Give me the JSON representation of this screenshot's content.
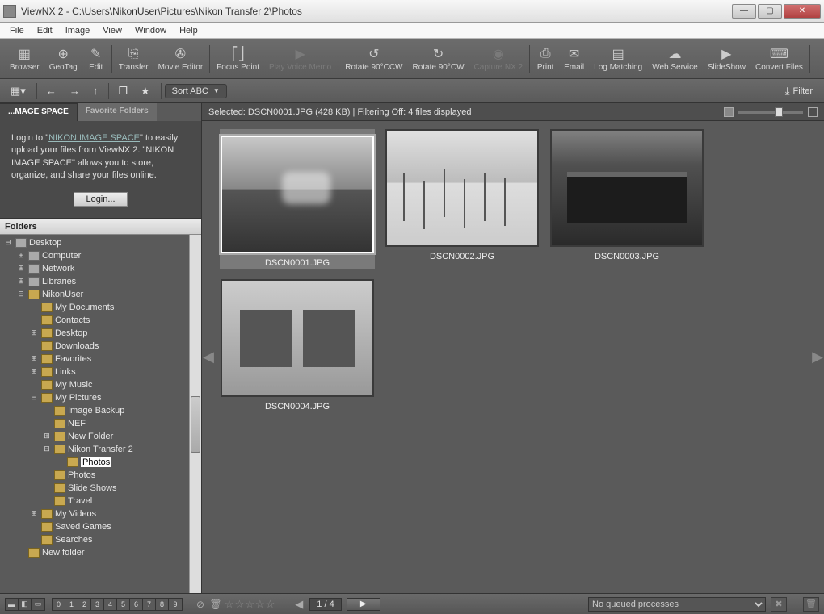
{
  "window": {
    "title": "ViewNX 2 - C:\\Users\\NikonUser\\Pictures\\Nikon Transfer 2\\Photos"
  },
  "menu": [
    "File",
    "Edit",
    "Image",
    "View",
    "Window",
    "Help"
  ],
  "toolbar": [
    {
      "label": "Browser",
      "icon": "▦"
    },
    {
      "label": "GeoTag",
      "icon": "⊕"
    },
    {
      "label": "Edit",
      "icon": "✎"
    },
    {
      "label": "Transfer",
      "icon": "⎘"
    },
    {
      "label": "Movie Editor",
      "icon": "✇"
    },
    {
      "label": "Focus Point",
      "icon": "⎡⎦"
    },
    {
      "label": "Play Voice Memo",
      "icon": "▶",
      "disabled": true
    },
    {
      "label": "Rotate 90°CCW",
      "icon": "↺"
    },
    {
      "label": "Rotate 90°CW",
      "icon": "↻"
    },
    {
      "label": "Capture NX 2",
      "icon": "◉",
      "disabled": true
    },
    {
      "label": "Print",
      "icon": "⎙"
    },
    {
      "label": "Email",
      "icon": "✉"
    },
    {
      "label": "Log Matching",
      "icon": "▤"
    },
    {
      "label": "Web Service",
      "icon": "☁"
    },
    {
      "label": "SlideShow",
      "icon": "▶"
    },
    {
      "label": "Convert Files",
      "icon": "⌨"
    }
  ],
  "secbar": {
    "sort_label": "Sort ABC",
    "filter_label": "Filter"
  },
  "sidebar": {
    "tab_active": "...MAGE SPACE",
    "tab_inactive": "Favorite Folders",
    "nis_text_1": "Login to \"",
    "nis_link": "NIKON IMAGE SPACE",
    "nis_text_2": "\" to easily upload your files from ViewNX 2. \"NIKON IMAGE SPACE\" allows you to store, organize, and share your files online.",
    "login_label": "Login...",
    "folders_label": "Folders",
    "tree": [
      {
        "exp": "-",
        "indent": 0,
        "label": "Desktop",
        "type": "comp"
      },
      {
        "exp": "+",
        "indent": 1,
        "label": "Computer",
        "type": "comp"
      },
      {
        "exp": "+",
        "indent": 1,
        "label": "Network",
        "type": "comp"
      },
      {
        "exp": "+",
        "indent": 1,
        "label": "Libraries",
        "type": "comp"
      },
      {
        "exp": "-",
        "indent": 1,
        "label": "NikonUser",
        "type": "fold"
      },
      {
        "exp": " ",
        "indent": 2,
        "label": "My Documents",
        "type": "fold"
      },
      {
        "exp": " ",
        "indent": 2,
        "label": "Contacts",
        "type": "fold"
      },
      {
        "exp": "+",
        "indent": 2,
        "label": "Desktop",
        "type": "fold"
      },
      {
        "exp": " ",
        "indent": 2,
        "label": "Downloads",
        "type": "fold"
      },
      {
        "exp": "+",
        "indent": 2,
        "label": "Favorites",
        "type": "fold"
      },
      {
        "exp": "+",
        "indent": 2,
        "label": "Links",
        "type": "fold"
      },
      {
        "exp": " ",
        "indent": 2,
        "label": "My Music",
        "type": "fold"
      },
      {
        "exp": "-",
        "indent": 2,
        "label": "My Pictures",
        "type": "fold"
      },
      {
        "exp": " ",
        "indent": 3,
        "label": "Image Backup",
        "type": "fold"
      },
      {
        "exp": " ",
        "indent": 3,
        "label": "NEF",
        "type": "fold"
      },
      {
        "exp": "+",
        "indent": 3,
        "label": "New Folder",
        "type": "fold"
      },
      {
        "exp": "-",
        "indent": 3,
        "label": "Nikon Transfer 2",
        "type": "fold"
      },
      {
        "exp": " ",
        "indent": 4,
        "label": "Photos",
        "type": "fold",
        "sel": true
      },
      {
        "exp": " ",
        "indent": 3,
        "label": "Photos",
        "type": "fold"
      },
      {
        "exp": " ",
        "indent": 3,
        "label": "Slide Shows",
        "type": "fold"
      },
      {
        "exp": " ",
        "indent": 3,
        "label": "Travel",
        "type": "fold"
      },
      {
        "exp": "+",
        "indent": 2,
        "label": "My Videos",
        "type": "fold"
      },
      {
        "exp": " ",
        "indent": 2,
        "label": "Saved Games",
        "type": "fold"
      },
      {
        "exp": " ",
        "indent": 2,
        "label": "Searches",
        "type": "fold"
      },
      {
        "exp": " ",
        "indent": 1,
        "label": "New folder",
        "type": "fold"
      }
    ]
  },
  "content": {
    "infobar_text": "Selected: DSCN0001.JPG (428 KB) | Filtering Off: 4 files displayed",
    "thumbs": [
      {
        "caption": "DSCN0001.JPG",
        "ph": "ph1",
        "sel": true
      },
      {
        "caption": "DSCN0002.JPG",
        "ph": "ph2"
      },
      {
        "caption": "DSCN0003.JPG",
        "ph": "ph3"
      },
      {
        "caption": "DSCN0004.JPG",
        "ph": "ph4"
      }
    ]
  },
  "statusbar": {
    "label_nums": [
      "0",
      "1",
      "2",
      "3",
      "4",
      "5",
      "6",
      "7",
      "8",
      "9"
    ],
    "page_text": "1 / 4",
    "queue_text": "No queued processes"
  }
}
